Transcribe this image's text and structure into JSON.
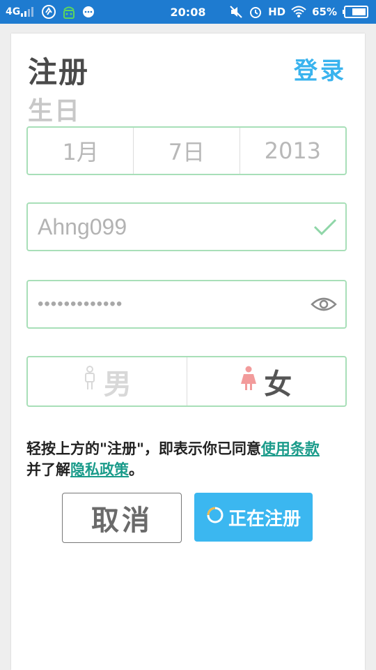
{
  "status_bar": {
    "network": "4G",
    "time": "20:08",
    "hd": "HD",
    "battery": "65%",
    "icons": [
      "signal-icon",
      "app-icon",
      "android-icon",
      "chat-icon",
      "mute-icon",
      "alarm-icon",
      "wifi-icon",
      "battery-icon"
    ]
  },
  "header": {
    "title": "注册",
    "login_link": "登录",
    "section": "生日"
  },
  "birthday": {
    "month": "1月",
    "day": "7日",
    "year": "2013"
  },
  "username": {
    "value": "Ahng099",
    "valid_icon": "check-icon"
  },
  "password": {
    "masked_value": "•••••••••••••",
    "toggle_icon": "eye-icon"
  },
  "gender": {
    "male_label": "男",
    "female_label": "女",
    "selected": "女",
    "male_icon": "male-icon",
    "female_icon": "female-icon"
  },
  "terms": {
    "prefix": "轻按上方的\"注册\"，即表示你已同意",
    "terms_link": "使用条款",
    "middle": "并了解",
    "privacy_link": "隐私政策",
    "suffix": "。"
  },
  "buttons": {
    "cancel": "取消",
    "register": "正在注册"
  },
  "colors": {
    "status_bar": "#1e7bd0",
    "accent": "#39b3ee",
    "field_border": "#a8dfb8",
    "link": "#1a9b8a",
    "female_accent": "#f29b9b"
  }
}
